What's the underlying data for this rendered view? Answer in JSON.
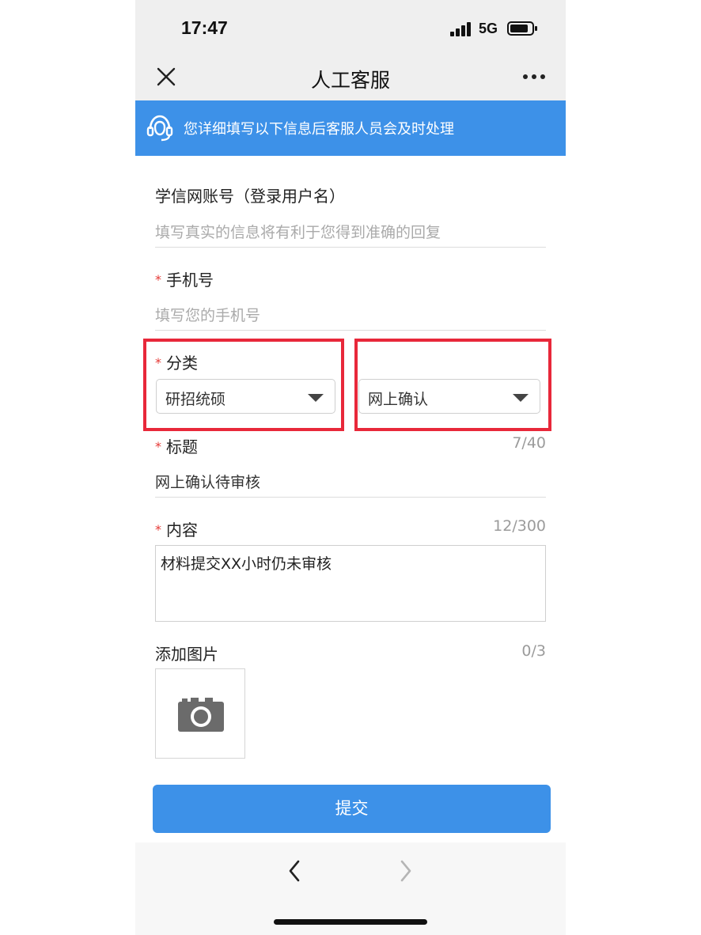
{
  "status": {
    "time": "17:47",
    "network": "5G"
  },
  "nav": {
    "title": "人工客服",
    "close_icon": "close-icon",
    "more_icon": "more-icon"
  },
  "banner": {
    "icon": "customer-service-headset-icon",
    "text": "您详细填写以下信息后客服人员会及时处理"
  },
  "form": {
    "account": {
      "label": "学信网账号（登录用户名）",
      "placeholder": "填写真实的信息将有利于您得到准确的回复"
    },
    "phone": {
      "required_mark": "*",
      "label": "手机号",
      "placeholder": "填写您的手机号"
    },
    "category": {
      "required_mark": "*",
      "label": "分类",
      "primary_value": "研招统硕",
      "secondary_value": "网上确认"
    },
    "title": {
      "required_mark": "*",
      "label": "标题",
      "counter": "7/40",
      "value": "网上确认待审核"
    },
    "content": {
      "required_mark": "*",
      "label": "内容",
      "counter": "12/300",
      "value": "材料提交XX小时仍未审核"
    },
    "images": {
      "label": "添加图片",
      "counter": "0/3",
      "icon": "camera-icon"
    },
    "submit_label": "提交"
  },
  "highlight_color": "#e8283a",
  "accent_color": "#3d91e8"
}
